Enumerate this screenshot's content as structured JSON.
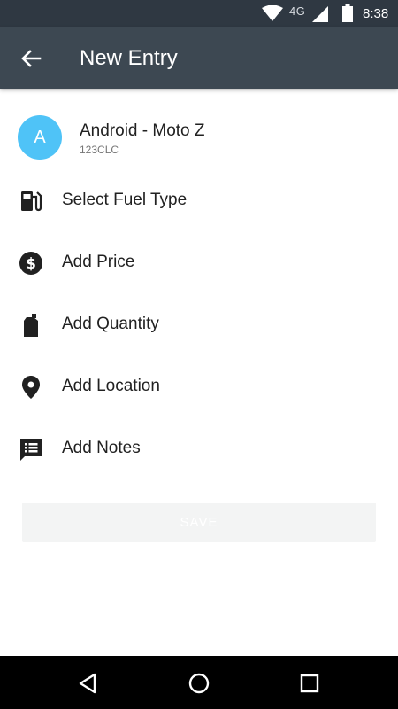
{
  "status_bar": {
    "network": "4G",
    "time": "8:38"
  },
  "app_bar": {
    "title": "New Entry"
  },
  "vehicle": {
    "avatar_letter": "A",
    "name": "Android - Moto Z",
    "plate": "123CLC"
  },
  "menu_items": [
    {
      "label": "Select Fuel Type",
      "icon": "fuel-pump-icon"
    },
    {
      "label": "Add Price",
      "icon": "dollar-icon"
    },
    {
      "label": "Add Quantity",
      "icon": "jerry-can-icon"
    },
    {
      "label": "Add Location",
      "icon": "location-pin-icon"
    },
    {
      "label": "Add Notes",
      "icon": "notes-icon"
    }
  ],
  "save_button": {
    "label": "Save",
    "enabled": false
  },
  "colors": {
    "status_bar": "#2f3842",
    "app_bar": "#3d4852",
    "avatar": "#4fc3f7",
    "nav_bar": "#000000"
  }
}
